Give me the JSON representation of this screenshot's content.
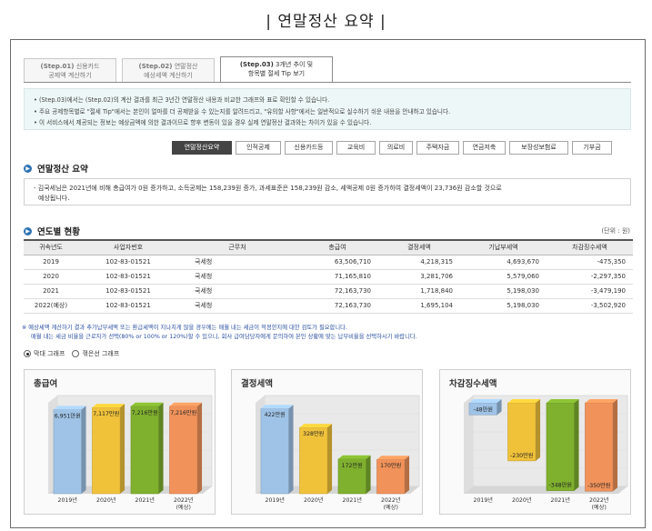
{
  "page_title": "| 연말정산 요약 |",
  "tabs": [
    {
      "step": "(Step.01)",
      "line1": " 신용카드",
      "line2": "공제액 계산하기"
    },
    {
      "step": "(Step.02)",
      "line1": " 연말정산",
      "line2": "예상세액 계산하기"
    },
    {
      "step": "(Step.03)",
      "line1": " 3개년 추이 및",
      "line2": "항목별 절세 Tip 보기"
    }
  ],
  "notice": [
    "• (Step.03)에서는 (Step.02)의 계산 결과를 최근 3년간 연말정산 내용과 비교한 그래프와 표로 확인할 수 있습니다.",
    "• 주요 공제항목별로 \"절세 Tip\"에서는 본인이 얼마를 더 공제받을 수 있는지를 알려드리고, \"유의할 사항\"에서는 일반적으로 실수하기 쉬운 내용을 안내하고 있습니다.",
    "• 이 서비스에서 제공되는 정보는 예상금액에 의한 결과이므로 향후 변동이 있을 경우 실제 연말정산 결과와는 차이가 있을 수 있습니다."
  ],
  "subtabs": [
    "연말정산요약",
    "인적공제",
    "신용카드등",
    "교육비",
    "의료비",
    "주택자금",
    "연금저축",
    "보장성보험료",
    "기부금"
  ],
  "summary": {
    "title": "연말정산 요약",
    "line1": "- 김국세님은 2021년에 비해 총급여가 0원 증가하고, 소득공제는 158,239원 증가, 과세표준은 158,239원 감소, 세액공제 0원 증가하여 결정세액이 23,736원 감소할 것으로",
    "line2": "예상됩니다."
  },
  "yearly": {
    "title": "연도별 현황",
    "unit": "(단위 : 원)",
    "headers": [
      "귀속년도",
      "사업자번호",
      "근무처",
      "총급여",
      "결정세액",
      "기납부세액",
      "차감징수세액"
    ],
    "rows": [
      [
        "2019",
        "102-83-01521",
        "국세청",
        "63,506,710",
        "4,218,315",
        "4,693,670",
        "-475,350"
      ],
      [
        "2020",
        "102-83-01521",
        "국세청",
        "71,165,810",
        "3,281,706",
        "5,579,060",
        "-2,297,350"
      ],
      [
        "2021",
        "102-83-01521",
        "국세청",
        "72,163,730",
        "1,718,840",
        "5,198,030",
        "-3,479,190"
      ],
      [
        "2022(예상)",
        "102-83-01521",
        "국세청",
        "72,163,730",
        "1,695,104",
        "5,198,030",
        "-3,502,920"
      ]
    ]
  },
  "warn": {
    "line1": "※ 예상세액 계산하기 결과 추가납부세액 또는 환급세액이 지나치게 많을 경우에는 매월 내는 세금이 적정한지에 대한 검토가 필요합니다.",
    "line2": "매월 내는 세금 비율을 근로자가 선택(80% or 100% or 120%)할 수 있으니, 회사 급여담당자에게 문의하여 본인 상황에 맞는 납부비율을 선택하시기 바랍니다."
  },
  "chart_types": {
    "bar": "막대 그래프",
    "line": "꺾은선 그래프",
    "selected": "bar"
  },
  "chart_data": [
    {
      "type": "bar",
      "title": "총급여",
      "categories": [
        "2019년",
        "2020년",
        "2021년",
        "2022년\n(예상)"
      ],
      "values": [
        6951,
        7117,
        7216,
        7216
      ],
      "labels": [
        "6,951만원",
        "7,117만원",
        "7,216만원",
        "7,216만원"
      ],
      "ylim": [
        0,
        7500
      ],
      "colors": [
        "#9fc3e6",
        "#f0c23a",
        "#7fb02e",
        "#f0925a"
      ]
    },
    {
      "type": "bar",
      "title": "결정세액",
      "categories": [
        "2019년",
        "2020년",
        "2021년",
        "2022년\n(예상)"
      ],
      "values": [
        422,
        328,
        172,
        170
      ],
      "labels": [
        "422만원",
        "328만원",
        "172만원",
        "170만원"
      ],
      "ylim": [
        0,
        450
      ],
      "colors": [
        "#9fc3e6",
        "#f0c23a",
        "#7fb02e",
        "#f0925a"
      ]
    },
    {
      "type": "bar",
      "title": "차감징수세액",
      "categories": [
        "2019년",
        "2020년",
        "2021년",
        "2022년\n(예상)"
      ],
      "values": [
        -48,
        -230,
        -348,
        -350
      ],
      "labels": [
        "-48만원",
        "-230만원",
        "-348만원",
        "-350만원"
      ],
      "ylim": [
        -360,
        0
      ],
      "colors": [
        "#9fc3e6",
        "#f0c23a",
        "#7fb02e",
        "#f0925a"
      ]
    }
  ]
}
